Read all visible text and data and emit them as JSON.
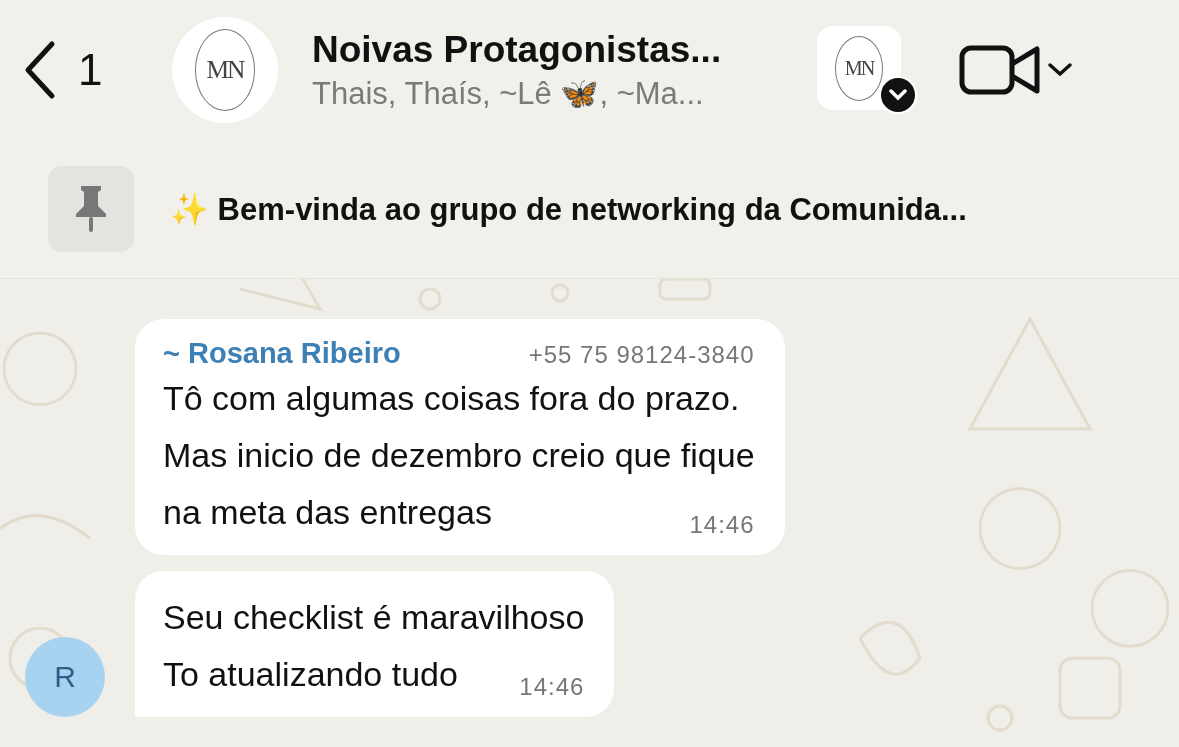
{
  "header": {
    "back_count": "1",
    "logo_text": "MN",
    "title": "Noivas Protagonistas...",
    "subtitle": "Thais, Thaís, ~Lê 🦋, ~Ma...",
    "community_logo_text": "MN"
  },
  "pinned": {
    "text": "✨ Bem-vinda ao grupo de networking da Comunida..."
  },
  "messages": [
    {
      "sender": "~ Rosana Ribeiro",
      "phone": "+55 75 98124-3840",
      "lines": [
        "Tô com algumas coisas fora do prazo.",
        "Mas inicio de dezembro creio que fique",
        "na meta das entregas"
      ],
      "time": "14:46",
      "tail": false
    },
    {
      "lines": [
        "Seu checklist é maravilhoso",
        "To atualizando tudo"
      ],
      "time": "14:46",
      "tail": true,
      "avatar": "R"
    }
  ]
}
